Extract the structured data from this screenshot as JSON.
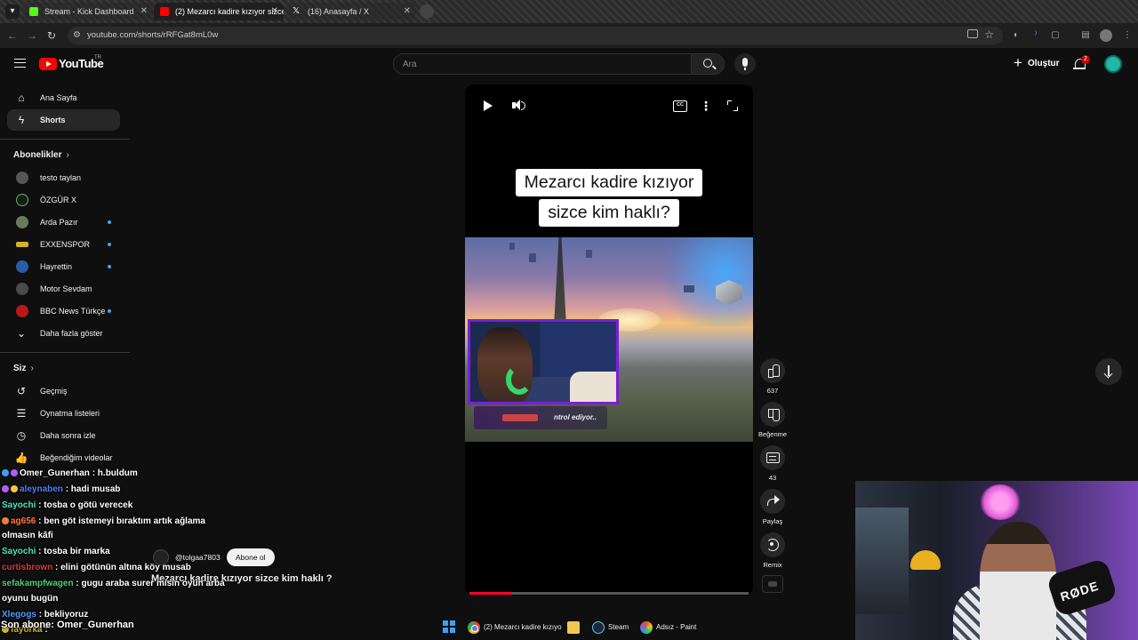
{
  "browser": {
    "tabs": [
      {
        "title": "Stream - Kick Dashboard",
        "favicon": "kick-icon"
      },
      {
        "title": "(2) Mezarcı kadire kızıyor sizce k",
        "favicon": "youtube-icon"
      },
      {
        "title": "(16) Anasayfa / X",
        "favicon": "x-icon"
      }
    ],
    "url": "youtube.com/shorts/rRFGat8mL0w"
  },
  "header": {
    "logo": "YouTube",
    "country": "TR",
    "search_placeholder": "Ara",
    "create_label": "Oluştur",
    "notification_count": "2"
  },
  "sidebar": {
    "main": [
      {
        "label": "Ana Sayfa",
        "icon": "home-icon"
      },
      {
        "label": "Shorts",
        "icon": "shorts-icon"
      }
    ],
    "subscriptions_title": "Abonelikler",
    "subscriptions": [
      {
        "label": "testo taylan",
        "live": false
      },
      {
        "label": "ÖZGÜR X",
        "live": false
      },
      {
        "label": "Arda Pazır",
        "live": true
      },
      {
        "label": "EXXENSPOR",
        "live": true
      },
      {
        "label": "Hayrettin",
        "live": true
      },
      {
        "label": "Motor Sevdam",
        "live": false
      },
      {
        "label": "BBC News Türkçe",
        "live": true
      },
      {
        "label": "Daha fazla göster",
        "live": false
      }
    ],
    "you_title": "Siz",
    "you": [
      {
        "label": "Geçmiş",
        "icon": "history-icon"
      },
      {
        "label": "Oynatma listeleri",
        "icon": "playlist-icon"
      },
      {
        "label": "Daha sonra izle",
        "icon": "clock-icon"
      },
      {
        "label": "Beğendiğim videolar",
        "icon": "like-icon"
      }
    ]
  },
  "short": {
    "caption_line1": "Mezarcı kadire kızıyor",
    "caption_line2": "sizce kim haklı?",
    "scene_subtitle": "ntrol ediyor..",
    "progress": 0.15,
    "channel": "@tolgaa7803",
    "subscribe_label": "Abone ol",
    "title": "Mezarcı kadire kızıyor sizce kim haklı ?"
  },
  "actions": {
    "likes": "637",
    "dislike_label": "Beğenme",
    "comments": "43",
    "share_label": "Paylaş",
    "remix_label": "Remix"
  },
  "chat": {
    "messages": [
      {
        "user": "Omer_Gunerhan",
        "text": ": h.buldum",
        "color": "#ffffff"
      },
      {
        "user": "aleynaben",
        "text": ": hadi musab",
        "color": "#4f7dff"
      },
      {
        "user": "Sayochi",
        "text": ": tosba o götü verecek",
        "color": "#4fe3c2"
      },
      {
        "user": "ag656",
        "text": ": ben göt istemeyi bıraktım artık ağlama",
        "color": "#ff7a3a"
      },
      {
        "user": "",
        "text": "olmasın kâfi",
        "color": "#ffffff"
      },
      {
        "user": "Sayochi",
        "text": ": tosba bir marka",
        "color": "#4fe3c2"
      },
      {
        "user": "curtisbrown",
        "text": ": elini götünün altına köy musab",
        "color": "#d43b3b"
      },
      {
        "user": "sefakampfwagen",
        "text": ": gugu araba surer misin oyun arba",
        "color": "#4fcf7a"
      },
      {
        "user": "",
        "text": "oyunu bugün",
        "color": "#ffffff"
      },
      {
        "user": "Xlegogs",
        "text": ": bekliyoruz",
        "color": "#4f9dff"
      },
      {
        "user": "fayorka",
        "text": ":",
        "color": "#d4b13b"
      }
    ],
    "last_subscriber": "Son abone: Omer_Gunerhan"
  },
  "facecam": {
    "mic_brand": "RØDE"
  },
  "taskbar": {
    "items": [
      {
        "label": "(2) Mezarcı kadire kızıyo",
        "icon": "chrome-icon"
      },
      {
        "label": "",
        "icon": "folder-icon"
      },
      {
        "label": "Steam",
        "icon": "steam-icon"
      },
      {
        "label": "Adsız - Paint",
        "icon": "paint-icon"
      }
    ]
  }
}
